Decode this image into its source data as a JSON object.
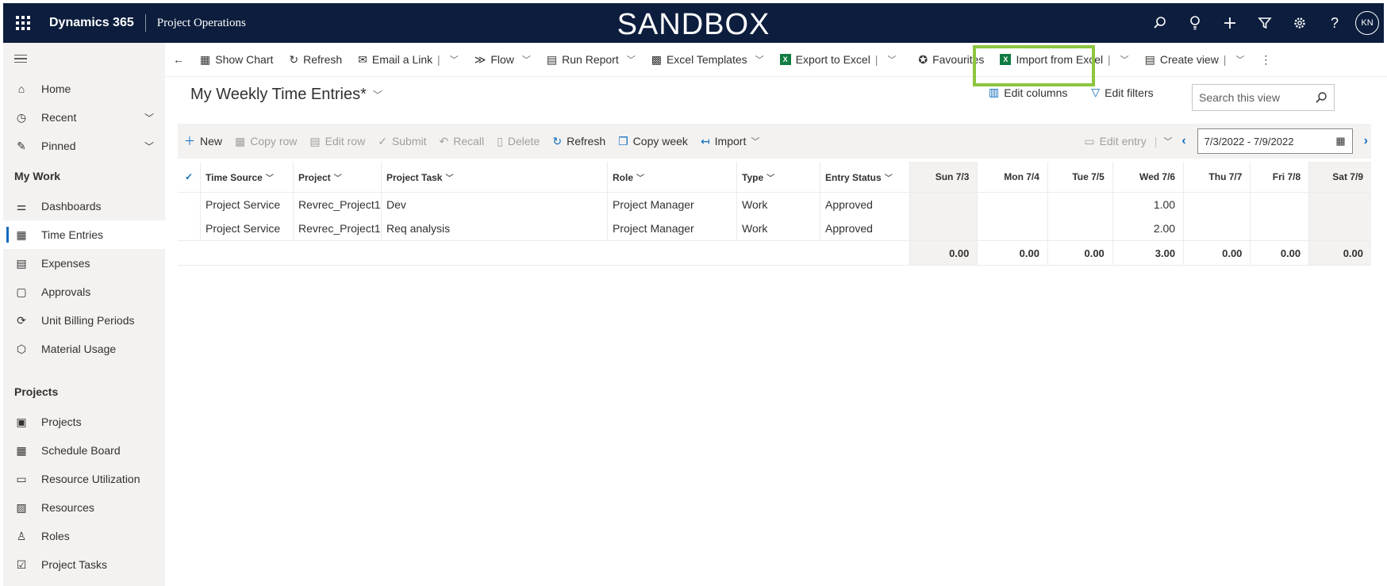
{
  "topbar": {
    "brand": "Dynamics 365",
    "app": "Project Operations",
    "environment": "SANDBOX",
    "avatar": "KN",
    "icons": [
      "search-icon",
      "lightbulb-icon",
      "plus-icon",
      "filter-icon",
      "gear-icon",
      "help-icon"
    ]
  },
  "sidebar": {
    "top_items": [
      {
        "label": "Home",
        "icon": "home-icon"
      },
      {
        "label": "Recent",
        "icon": "clock-icon",
        "chevron": true
      },
      {
        "label": "Pinned",
        "icon": "pin-icon",
        "chevron": true
      }
    ],
    "groups": [
      {
        "title": "My Work",
        "items": [
          {
            "label": "Dashboards",
            "icon": "dashboard-icon"
          },
          {
            "label": "Time Entries",
            "icon": "calendar-icon",
            "active": true
          },
          {
            "label": "Expenses",
            "icon": "receipt-icon"
          },
          {
            "label": "Approvals",
            "icon": "document-icon"
          },
          {
            "label": "Unit Billing Periods",
            "icon": "cycle-icon"
          },
          {
            "label": "Material Usage",
            "icon": "box-icon"
          }
        ]
      },
      {
        "title": "Projects",
        "items": [
          {
            "label": "Projects",
            "icon": "projects-icon"
          },
          {
            "label": "Schedule Board",
            "icon": "board-icon"
          },
          {
            "label": "Resource Utilization",
            "icon": "utilization-icon"
          },
          {
            "label": "Resources",
            "icon": "resources-icon"
          },
          {
            "label": "Roles",
            "icon": "roles-icon"
          },
          {
            "label": "Project Tasks",
            "icon": "tasks-icon"
          }
        ]
      }
    ]
  },
  "commandbar": {
    "back": "back-arrow-icon",
    "show_chart": "Show Chart",
    "refresh": "Refresh",
    "email_link": "Email a Link",
    "flow": "Flow",
    "run_report": "Run Report",
    "excel_templates": "Excel Templates",
    "export_excel": "Export to Excel",
    "favourites": "Favourites",
    "import_excel": "Import from Excel",
    "create_view": "Create view"
  },
  "view": {
    "title": "My Weekly Time Entries*",
    "edit_columns": "Edit columns",
    "edit_filters": "Edit filters",
    "search_placeholder": "Search this view"
  },
  "gridbar": {
    "new": "New",
    "copy_row": "Copy row",
    "edit_row": "Edit row",
    "submit": "Submit",
    "recall": "Recall",
    "delete": "Delete",
    "refresh": "Refresh",
    "copy_week": "Copy week",
    "import": "Import",
    "edit_entry": "Edit entry",
    "date_range": "7/3/2022 - 7/9/2022"
  },
  "table": {
    "columns": [
      "Time Source",
      "Project",
      "Project Task",
      "Role",
      "Type",
      "Entry Status"
    ],
    "days": [
      "Sun 7/3",
      "Mon 7/4",
      "Tue 7/5",
      "Wed 7/6",
      "Thu 7/7",
      "Fri 7/8",
      "Sat 7/9"
    ],
    "rows": [
      {
        "time_source": "Project Service",
        "project": "Revrec_Project1",
        "task": "Dev",
        "role": "Project Manager",
        "type": "Work",
        "status": "Approved",
        "hours": [
          "",
          "",
          "",
          "1.00",
          "",
          "",
          ""
        ]
      },
      {
        "time_source": "Project Service",
        "project": "Revrec_Project1",
        "task": "Req analysis",
        "role": "Project Manager",
        "type": "Work",
        "status": "Approved",
        "hours": [
          "",
          "",
          "",
          "2.00",
          "",
          "",
          ""
        ]
      }
    ],
    "totals": [
      "0.00",
      "0.00",
      "0.00",
      "3.00",
      "0.00",
      "0.00",
      "0.00"
    ]
  }
}
